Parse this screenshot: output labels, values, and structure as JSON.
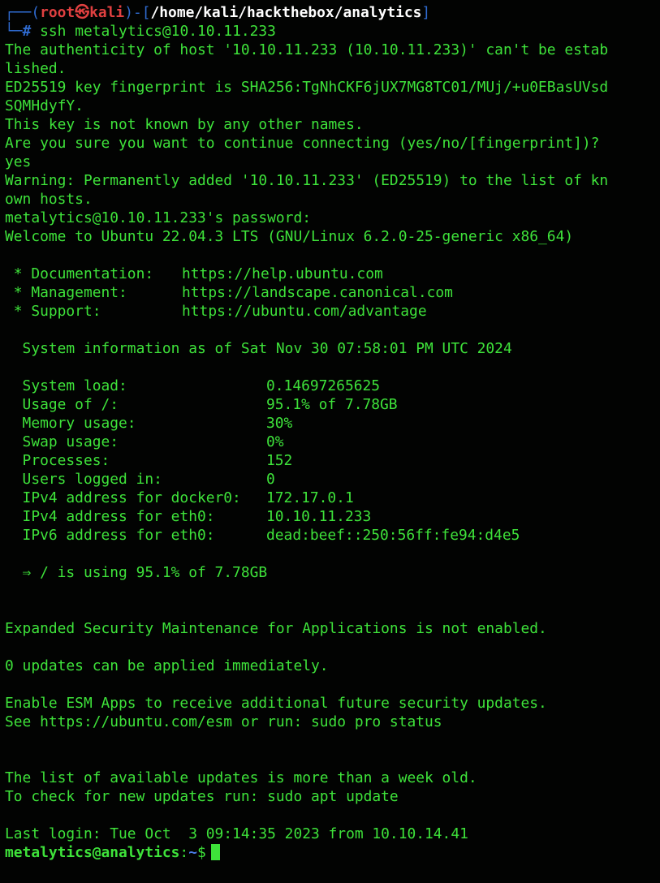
{
  "terminal": {
    "prompt_top": {
      "frame_open": "┌──(",
      "user": "root",
      "skull": "㉿",
      "host": "kali",
      "frame_mid": ")-[",
      "path": "/home/kali/hackthebox/analytics",
      "frame_close": "]",
      "frame_bottom": "└─",
      "hash": "#",
      "command": "ssh metalytics@10.10.11.233"
    },
    "ssh_output": [
      "The authenticity of host '10.10.11.233 (10.10.11.233)' can't be estab",
      "lished.",
      "ED25519 key fingerprint is SHA256:TgNhCKF6jUX7MG8TC01/MUj/+u0EBasUVsd",
      "SQMHdyfY.",
      "This key is not known by any other names.",
      "Are you sure you want to continue connecting (yes/no/[fingerprint])?",
      "yes",
      "Warning: Permanently added '10.10.11.233' (ED25519) to the list of kn",
      "own hosts.",
      "metalytics@10.10.11.233's password:",
      "Welcome to Ubuntu 22.04.3 LTS (GNU/Linux 6.2.0-25-generic x86_64)"
    ],
    "links": [
      {
        "label": " * Documentation:",
        "url": "https://help.ubuntu.com"
      },
      {
        "label": " * Management:",
        "url": "https://landscape.canonical.com"
      },
      {
        "label": " * Support:",
        "url": "https://ubuntu.com/advantage"
      }
    ],
    "sysinfo_header": "  System information as of Sat Nov 30 07:58:01 PM UTC 2024",
    "sysinfo": [
      {
        "label": "  System load:",
        "value": "0.14697265625"
      },
      {
        "label": "  Usage of /:",
        "value": "95.1% of 7.78GB"
      },
      {
        "label": "  Memory usage:",
        "value": "30%"
      },
      {
        "label": "  Swap usage:",
        "value": "0%"
      },
      {
        "label": "  Processes:",
        "value": "152"
      },
      {
        "label": "  Users logged in:",
        "value": "0"
      },
      {
        "label": "  IPv4 address for docker0:",
        "value": "172.17.0.1"
      },
      {
        "label": "  IPv4 address for eth0:",
        "value": "10.10.11.233"
      },
      {
        "label": "  IPv6 address for eth0:",
        "value": "dead:beef::250:56ff:fe94:d4e5"
      }
    ],
    "usage_warning": "  ⇒ / is using 95.1% of 7.78GB",
    "esm_line": "Expanded Security Maintenance for Applications is not enabled.",
    "updates_line": "0 updates can be applied immediately.",
    "esm_apps_1": "Enable ESM Apps to receive additional future security updates.",
    "esm_apps_2": "See https://ubuntu.com/esm or run: sudo pro status",
    "stale_1": "The list of available updates is more than a week old.",
    "stale_2": "To check for new updates run: sudo apt update",
    "last_login": "Last login: Tue Oct  3 09:14:35 2023 from 10.10.14.41",
    "final_prompt": {
      "user_host": "metalytics@analytics",
      "sep": ":",
      "path": "~",
      "symbol": "$"
    }
  },
  "colors": {
    "background": "#020302",
    "text": "#3ee23a",
    "frame": "#2f6bd0",
    "root_user": "#e04040",
    "path": "#ffffff",
    "home_path": "#4a7ce8"
  }
}
